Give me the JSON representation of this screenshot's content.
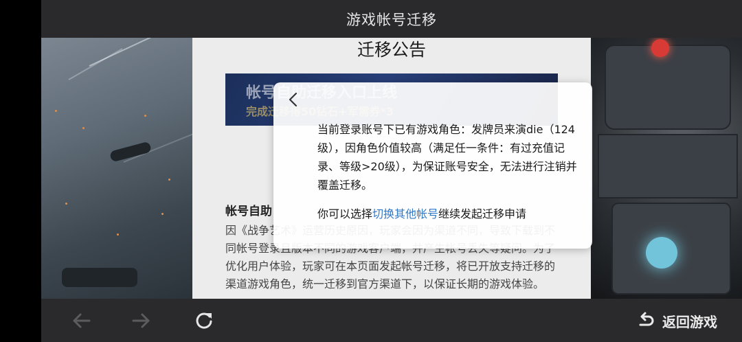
{
  "header": {
    "title": "游戏帐号迁移"
  },
  "article": {
    "title": "迁移公告",
    "banner_headline": "帐号自助迁移入口上线",
    "banner_subline": "完成迁移得50钻石+军需券*3",
    "section_heading": "帐号自助",
    "paragraph": "因《战争艺术》运营历史原因，玩家会因为渠道不同，导致下载到不同帐号登录且版本不同的游戏客户端，并产生帐号丢失等疑问。为了优化用户体验，玩家可在本页面发起帐号迁移，将已开放支持迁移的渠道游戏角色，统一迁移到官方渠道下，以保证长期的游戏体验。"
  },
  "dialog": {
    "message": "当前登录账号下已有游戏角色：发牌员来演die（124级），因角色价值较高（满足任一条件：有过充值记录、等级>20级），为保证账号安全，无法进行注销并覆盖迁移。",
    "prompt_prefix": "你可以选择",
    "switch_link": "切换其他帐号",
    "prompt_suffix": "继续发起迁移申请",
    "back_icon": "chevron-left-icon"
  },
  "bottom_bar": {
    "back_icon": "arrow-left-icon",
    "forward_icon": "arrow-right-icon",
    "refresh_icon": "refresh-icon",
    "return_icon": "return-icon",
    "return_label": "返回游戏"
  },
  "colors": {
    "link": "#2f78c8",
    "bar_background": "#2a2a2c",
    "disabled_icon": "#5c5c5e",
    "active_icon": "#e6e6e6"
  }
}
